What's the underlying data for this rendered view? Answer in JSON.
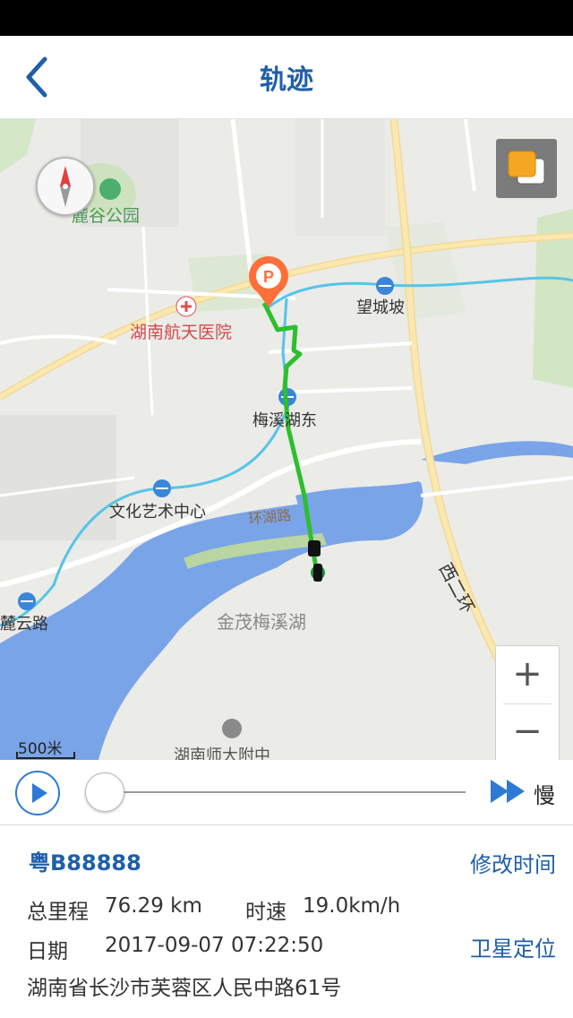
{
  "header": {
    "title": "轨迹"
  },
  "map": {
    "labels": {
      "park": "麓谷公园",
      "hospital": "湖南航天医院",
      "station1": "望城坡",
      "station2": "梅溪湖东",
      "station3": "文化艺术中心",
      "road1": "环湖路",
      "station4": "麓云路",
      "lake": "金茂梅溪湖",
      "school": "湖南师大附中",
      "ring": "西二环"
    },
    "scale_label": "500米",
    "zoom_in": "+",
    "zoom_out": "−",
    "parking_marker": "P"
  },
  "playback": {
    "speed_label": "慢",
    "progress": 0.0
  },
  "info": {
    "plate": "粤B88888",
    "edit_time": "修改时间",
    "mileage_label": "总里程",
    "mileage_value": "76.29 km",
    "speed_label": "时速",
    "speed_value": "19.0km/h",
    "date_label": "日期",
    "date_value": "2017-09-07 07:22:50",
    "satellite": "卫星定位",
    "address": "湖南省长沙市芙蓉区人民中路61号"
  }
}
